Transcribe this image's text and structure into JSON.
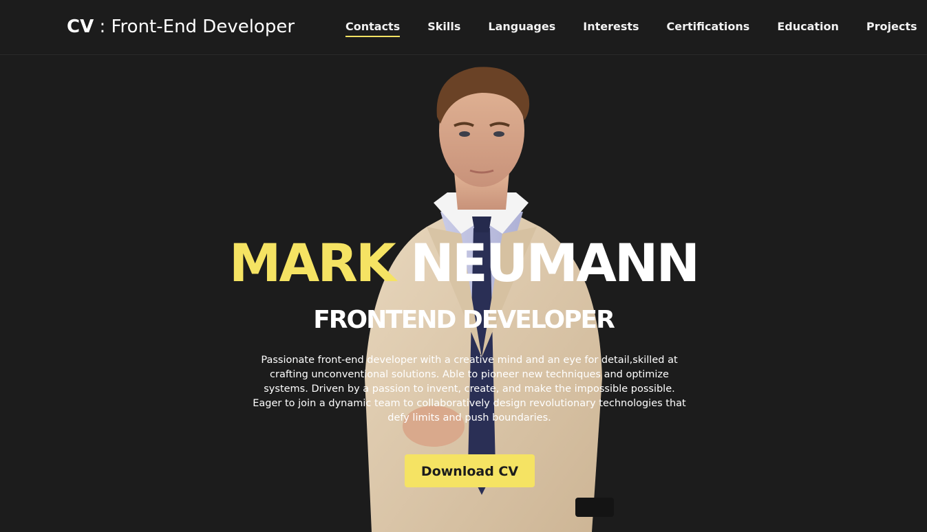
{
  "header": {
    "brand_strong": "CV",
    "brand_rest": " : Front-End Developer",
    "nav": [
      {
        "label": "Contacts",
        "active": true
      },
      {
        "label": "Skills",
        "active": false
      },
      {
        "label": "Languages",
        "active": false
      },
      {
        "label": "Interests",
        "active": false
      },
      {
        "label": "Certifications",
        "active": false
      },
      {
        "label": "Education",
        "active": false
      },
      {
        "label": "Projects",
        "active": false
      }
    ]
  },
  "hero": {
    "first_name": "MARK",
    "last_name": "NEUMANN",
    "role": "FRONTEND DEVELOPER",
    "summary": "Passionate front-end developer with a creative mind and an eye for detail,skilled at crafting unconventional solutions. Able to pioneer new techniques and optimize systems. Driven by a passion to invent, create, and make the impossible possible. Eager to join a dynamic team to collaboratively design revolutionary technologies that defy limits and push boundaries.",
    "download_label": "Download CV"
  },
  "colors": {
    "accent": "#f5e363",
    "background": "#1c1c1c",
    "text": "#ffffff"
  }
}
